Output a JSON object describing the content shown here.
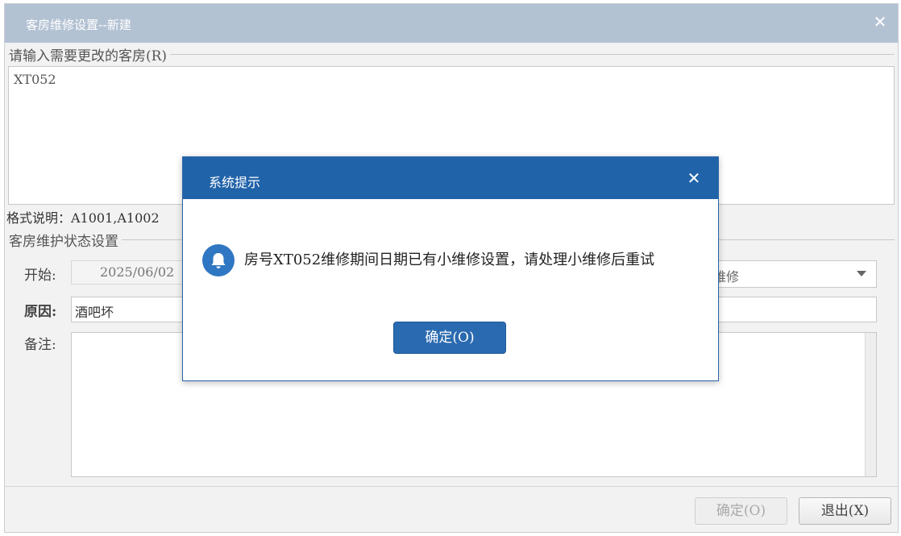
{
  "window": {
    "title": "客房维修设置--新建",
    "close_glyph": "✕"
  },
  "rooms_section": {
    "legend": "请输入需要更改的客房(R)",
    "value": "XT052",
    "format_hint": "格式说明：A1001,A1002"
  },
  "status_section": {
    "legend": "客房维护状态设置",
    "start_label": "开始:",
    "start_value": "2025/06/02",
    "status_value": "维修",
    "reason_label": "原因:",
    "reason_value": "酒吧坏",
    "note_label": "备注:",
    "note_value": ""
  },
  "footer": {
    "confirm_label": "确定(O)",
    "exit_label": "退出(X)"
  },
  "dialog": {
    "title": "系统提示",
    "close_glyph": "✕",
    "icon": "bell-icon",
    "message": "房号XT052维修期间日期已有小维修设置，请处理小维修后重试",
    "ok_label": "确定(O)"
  },
  "colors": {
    "titlebar": "#b3c2d3",
    "dialog_header": "#2163a9",
    "dialog_button": "#2a6ab0"
  }
}
